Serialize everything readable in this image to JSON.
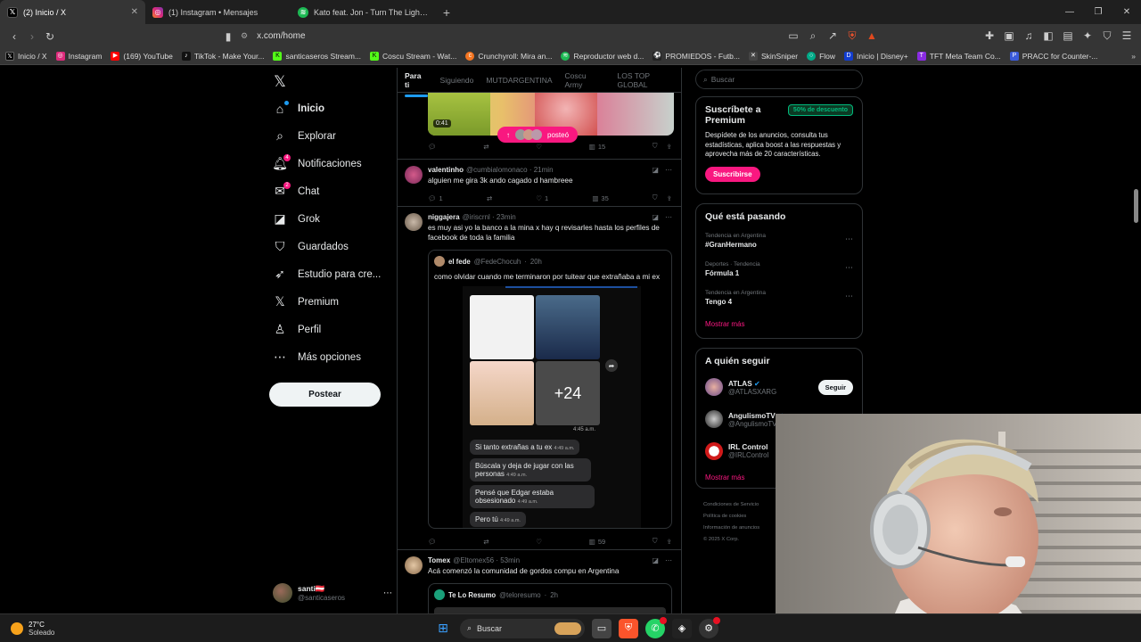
{
  "tabs": [
    {
      "title": "(2) Inicio / X",
      "icon": "x-logo-icon",
      "active": true
    },
    {
      "title": "(1) Instagram • Mensajes",
      "icon": "instagram-icon"
    },
    {
      "title": "Kato feat. Jon - Turn The Lights Off (",
      "icon": "spotify-icon"
    }
  ],
  "address": {
    "url": "x.com/home"
  },
  "bookmarks": [
    "Inicio / X",
    "Instagram",
    "(169) YouTube",
    "TikTok - Make Your...",
    "santicaseros Stream...",
    "Coscu Stream - Wat...",
    "Crunchyroll: Mira an...",
    "Reproductor web d...",
    "PROMIEDOS - Futb...",
    "SkinSniper",
    "Flow",
    "Inicio | Disney+",
    "TFT Meta Team Co...",
    "PRACC for Counter-..."
  ],
  "nav": {
    "items": [
      "Inicio",
      "Explorar",
      "Notificaciones",
      "Chat",
      "Grok",
      "Guardados",
      "Estudio para cre...",
      "Premium",
      "Perfil",
      "Más opciones"
    ],
    "notif_badge": "4",
    "chat_badge": "2",
    "post_button": "Postear"
  },
  "account": {
    "name": "santi🇦🇹",
    "handle": "@santicaseros"
  },
  "feed": {
    "tabs": [
      "Para ti",
      "Siguiendo",
      "MUTDARGENTINA",
      "Coscu Army",
      "LOS TOP GLOBAL"
    ],
    "top_post": {
      "video_time": "0:41",
      "posted_label": "posteó",
      "views": "15"
    },
    "posts": [
      {
        "name": "valentinho",
        "handle": "@cumbialomonaco",
        "time": "21min",
        "text": "alguien me gira 3k ando cagado d hambreee",
        "replies": "1",
        "likes": "1",
        "views": "35"
      },
      {
        "name": "niggajera",
        "handle": "@iriscrnl",
        "time": "23min",
        "text": "es muy asi yo la banco a la mina x hay q revisarles hasta los perfiles de facebook de toda la familia",
        "quote": {
          "name": "el fede",
          "handle": "@FedeChocuh",
          "time": "20h",
          "text": "como olvidar cuando me terminaron por tuitear que extrañaba a mi ex",
          "more_count": "+24",
          "img_time": "4:45 a.m.",
          "chat": [
            {
              "text": "Si tanto extrañas a tu ex",
              "time": "4:49 a.m."
            },
            {
              "text": "Búscala y deja de jugar con las personas",
              "time": "4:49 a.m."
            },
            {
              "text": "Pensé que Edgar estaba obsesionado",
              "time": "4:49 a.m."
            },
            {
              "text": "Pero tú",
              "time": "4:49 a.m."
            }
          ]
        },
        "views": "59"
      },
      {
        "name": "Tomex",
        "handle": "@Eltomex56",
        "time": "53min",
        "text": "Acá comenzó la comunidad de gordos compu en Argentina",
        "quote": {
          "name": "Te Lo Resumo",
          "handle": "@teloresumo",
          "time": "2h"
        }
      }
    ]
  },
  "sidebar": {
    "search_placeholder": "Buscar",
    "premium": {
      "title": "Suscríbete a Premium",
      "badge": "50% de descuento",
      "text": "Despídete de los anuncios, consulta tus estadísticas, aplica boost a las respuestas y aprovecha más de 20 características.",
      "button": "Suscribirse"
    },
    "trending": {
      "title": "Qué está pasando",
      "items": [
        {
          "cat": "Tendencia en Argentina",
          "title": "#GranHermano"
        },
        {
          "cat": "Deportes · Tendencia",
          "title": "Fórmula 1"
        },
        {
          "cat": "Tendencia en Argentina",
          "title": "Tengo 4"
        }
      ],
      "more": "Mostrar más"
    },
    "who": {
      "title": "A quién seguir",
      "items": [
        {
          "name": "ATLAS",
          "handle": "@ATLASXARG",
          "button": "Seguir"
        },
        {
          "name": "AngulismoTV",
          "handle": "@AngulismoTV"
        },
        {
          "name": "IRL Control",
          "handle": "@IRLControl"
        }
      ],
      "more": "Mostrar más"
    },
    "footer": [
      "Condiciones de Servicio",
      "Política de cookies",
      "Información de anuncios",
      "© 2025 X Corp."
    ]
  },
  "taskbar": {
    "temp": "27°C",
    "weather": "Soleado",
    "search": "Buscar"
  },
  "colors": {
    "accent": "#1d9bf0",
    "pink": "#f91880",
    "premium_green": "#00ba7c"
  }
}
